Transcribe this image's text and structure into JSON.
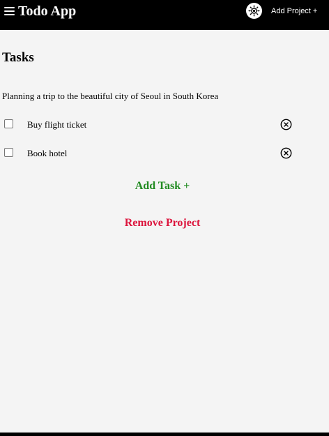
{
  "header": {
    "title": "Todo App",
    "add_project_label": "Add Project +",
    "icons": {
      "menu": "menu-icon",
      "theme": "sun-icon"
    }
  },
  "main": {
    "section_title": "Tasks",
    "project_description": "Planning a trip to the beautiful city of Seoul in South Korea",
    "tasks": [
      {
        "label": "Buy flight ticket",
        "checked": false
      },
      {
        "label": "Book hotel",
        "checked": false
      }
    ],
    "add_task_label": "Add Task +",
    "remove_project_label": "Remove Project"
  },
  "colors": {
    "header_bg": "#000000",
    "page_bg": "#f4f4f4",
    "add_task": "#228b22",
    "remove_project": "#dc143c"
  }
}
